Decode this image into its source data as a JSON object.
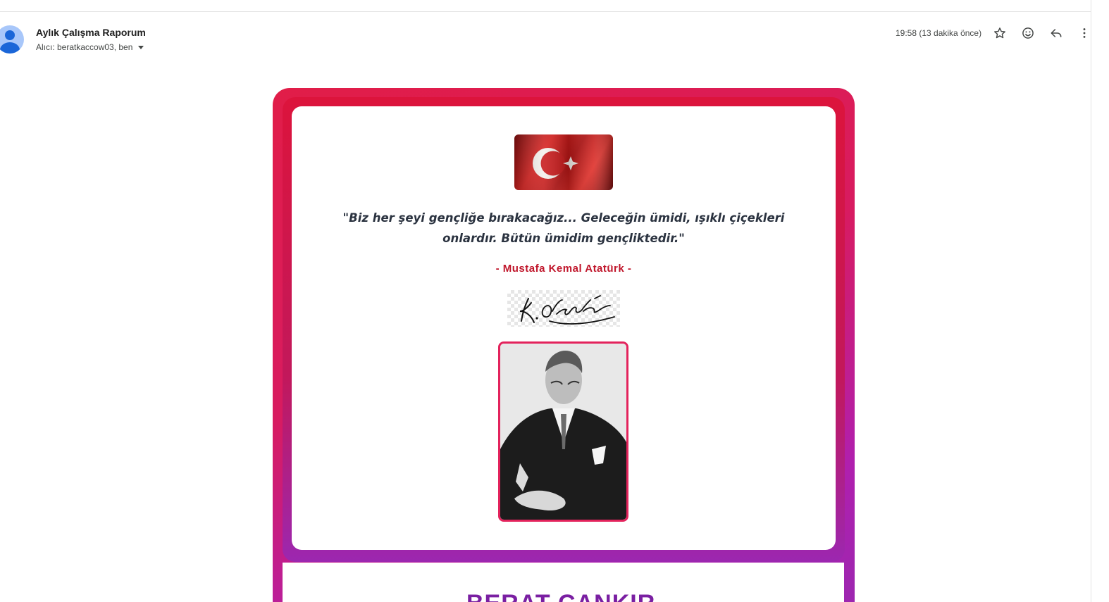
{
  "email": {
    "subject": "Aylık Çalışma Raporum",
    "recipients": "Alıcı: beratkaccow03, ben",
    "timestamp": "19:58 (13 dakika önce)"
  },
  "header_actions": [
    {
      "name": "star",
      "icon": "star-icon"
    },
    {
      "name": "react",
      "icon": "emoji-icon"
    },
    {
      "name": "reply",
      "icon": "reply-icon"
    },
    {
      "name": "more",
      "icon": "more-vert-icon"
    }
  ],
  "content": {
    "quote": "\"Biz her şeyi gençliğe bırakacağız... Geleceğin ümidi, ışıklı çiçekleri onlardır. Bütün ümidim gençliktedir.\"",
    "author": "- Mustafa Kemal Atatürk -",
    "signature_text": "K. Atatürk",
    "name_heading": "BERAT CANKIR"
  },
  "colors": {
    "card_gradient_start": "#e11d48",
    "card_gradient_end": "#9c27b0",
    "author_red": "#c0162b",
    "portrait_border": "#e3235c",
    "heading_purple": "#7a1fa2",
    "flag_red": "#d9201e"
  }
}
